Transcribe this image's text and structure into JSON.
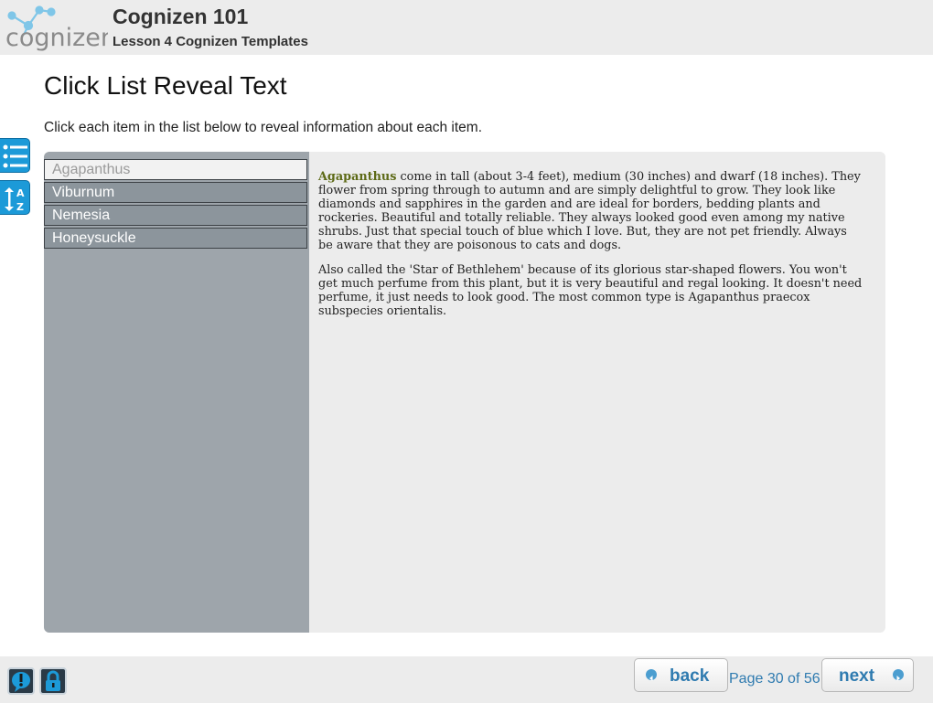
{
  "header": {
    "logo_text": "cognizen",
    "course_title": "Cognizen 101",
    "lesson_title": "Lesson 4 Cognizen Templates"
  },
  "page": {
    "title": "Click List Reveal Text",
    "instructions": "Click each item in the list below to reveal information about each item."
  },
  "side_tools": [
    {
      "name": "table-of-contents",
      "icon": "list-icon"
    },
    {
      "name": "glossary",
      "icon": "az-icon",
      "glyph_top": "A",
      "glyph_bottom": "Z"
    }
  ],
  "list": {
    "items": [
      {
        "label": "Agapanthus",
        "selected": true
      },
      {
        "label": "Viburnum",
        "selected": false
      },
      {
        "label": "Nemesia",
        "selected": false
      },
      {
        "label": "Honeysuckle",
        "selected": false
      }
    ]
  },
  "detail": {
    "term": "Agapanthus",
    "paragraph1_rest": " come in tall (about 3-4 feet), medium (30 inches) and dwarf (18 inches). They flower from spring through to autumn and are simply delightful to grow. They look like diamonds and sapphires in the garden and are ideal for borders, bedding plants and rockeries. Beautiful and totally reliable. They always looked good even among my native shrubs. Just that special touch of blue which I love. But, they are not pet friendly. Always be aware that they are poisonous to cats and dogs.",
    "paragraph2": "Also called the 'Star of Bethlehem' because of its glorious star-shaped flowers. You won't get much perfume from this plant, but it is very beautiful and regal looking. It doesn't need perfume, it just needs to look good.  The most common type is Agapanthus praecox subspecies orientalis."
  },
  "footer": {
    "help_icon": "exclamation-bubble-icon",
    "lock_icon": "lock-icon",
    "back_label": "back",
    "next_label": "next",
    "page_counter": "Page 30 of 56"
  },
  "colors": {
    "accent": "#2f7bb0",
    "tool_blue": "#1c9ad8",
    "term_green": "#5d6a16",
    "list_bg": "#9ea5ab"
  }
}
